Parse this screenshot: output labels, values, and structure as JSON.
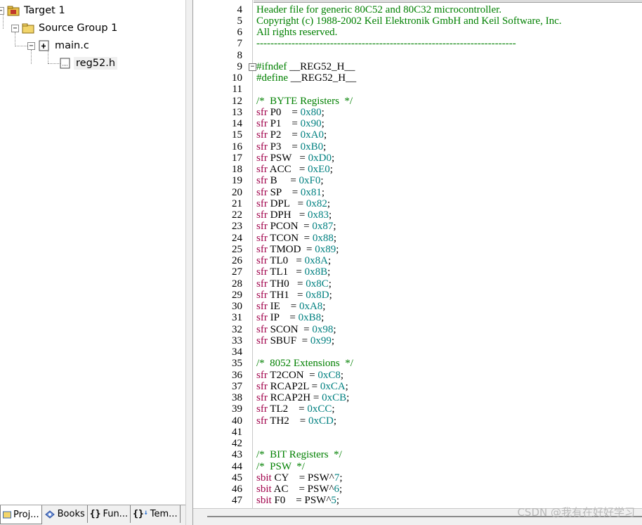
{
  "project_tree": {
    "target": "Target 1",
    "group": "Source Group 1",
    "file_main": "main.c",
    "file_header": "reg52.h"
  },
  "bottom_tabs": [
    {
      "label": "Proj...",
      "icon": "project-icon"
    },
    {
      "label": "Books",
      "icon": "books-icon"
    },
    {
      "label": "Fun...",
      "icon": "functions-icon"
    },
    {
      "label": "Tem...",
      "icon": "templates-icon"
    }
  ],
  "colors": {
    "keyword": "#a0004a",
    "number": "#008080",
    "comment": "#008000",
    "preprocessor": "#008000"
  },
  "code_lines": [
    {
      "n": "4",
      "parts": [
        {
          "c": "cmt",
          "t": "Header file for generic 80C52 and 80C32 microcontroller."
        }
      ]
    },
    {
      "n": "5",
      "parts": [
        {
          "c": "cmt",
          "t": "Copyright (c) 1988-2002 Keil Elektronik GmbH and Keil Software, Inc."
        }
      ]
    },
    {
      "n": "6",
      "parts": [
        {
          "c": "cmt",
          "t": "All rights reserved."
        }
      ]
    },
    {
      "n": "7",
      "parts": [
        {
          "c": "cmt",
          "t": "--------------------------------------------------------------------------"
        }
      ]
    },
    {
      "n": "8",
      "parts": []
    },
    {
      "n": "9",
      "fold": "−",
      "parts": [
        {
          "c": "pp",
          "t": "#ifndef"
        },
        {
          "c": "pln",
          "t": " __REG52_H__"
        }
      ]
    },
    {
      "n": "10",
      "parts": [
        {
          "c": "pp",
          "t": "#define"
        },
        {
          "c": "pln",
          "t": " __REG52_H__"
        }
      ]
    },
    {
      "n": "11",
      "parts": []
    },
    {
      "n": "12",
      "parts": [
        {
          "c": "cmt",
          "t": "/*  BYTE Registers  */"
        }
      ]
    },
    {
      "n": "13",
      "parts": [
        {
          "c": "kw",
          "t": "sfr"
        },
        {
          "c": "pln",
          "t": " P0    = "
        },
        {
          "c": "num",
          "t": "0x80"
        },
        {
          "c": "pln",
          "t": ";"
        }
      ]
    },
    {
      "n": "14",
      "parts": [
        {
          "c": "kw",
          "t": "sfr"
        },
        {
          "c": "pln",
          "t": " P1    = "
        },
        {
          "c": "num",
          "t": "0x90"
        },
        {
          "c": "pln",
          "t": ";"
        }
      ]
    },
    {
      "n": "15",
      "parts": [
        {
          "c": "kw",
          "t": "sfr"
        },
        {
          "c": "pln",
          "t": " P2    = "
        },
        {
          "c": "num",
          "t": "0xA0"
        },
        {
          "c": "pln",
          "t": ";"
        }
      ]
    },
    {
      "n": "16",
      "parts": [
        {
          "c": "kw",
          "t": "sfr"
        },
        {
          "c": "pln",
          "t": " P3    = "
        },
        {
          "c": "num",
          "t": "0xB0"
        },
        {
          "c": "pln",
          "t": ";"
        }
      ]
    },
    {
      "n": "17",
      "parts": [
        {
          "c": "kw",
          "t": "sfr"
        },
        {
          "c": "pln",
          "t": " PSW   = "
        },
        {
          "c": "num",
          "t": "0xD0"
        },
        {
          "c": "pln",
          "t": ";"
        }
      ]
    },
    {
      "n": "18",
      "parts": [
        {
          "c": "kw",
          "t": "sfr"
        },
        {
          "c": "pln",
          "t": " ACC   = "
        },
        {
          "c": "num",
          "t": "0xE0"
        },
        {
          "c": "pln",
          "t": ";"
        }
      ]
    },
    {
      "n": "19",
      "parts": [
        {
          "c": "kw",
          "t": "sfr"
        },
        {
          "c": "pln",
          "t": " B     = "
        },
        {
          "c": "num",
          "t": "0xF0"
        },
        {
          "c": "pln",
          "t": ";"
        }
      ]
    },
    {
      "n": "20",
      "parts": [
        {
          "c": "kw",
          "t": "sfr"
        },
        {
          "c": "pln",
          "t": " SP    = "
        },
        {
          "c": "num",
          "t": "0x81"
        },
        {
          "c": "pln",
          "t": ";"
        }
      ]
    },
    {
      "n": "21",
      "parts": [
        {
          "c": "kw",
          "t": "sfr"
        },
        {
          "c": "pln",
          "t": " DPL   = "
        },
        {
          "c": "num",
          "t": "0x82"
        },
        {
          "c": "pln",
          "t": ";"
        }
      ]
    },
    {
      "n": "22",
      "parts": [
        {
          "c": "kw",
          "t": "sfr"
        },
        {
          "c": "pln",
          "t": " DPH   = "
        },
        {
          "c": "num",
          "t": "0x83"
        },
        {
          "c": "pln",
          "t": ";"
        }
      ]
    },
    {
      "n": "23",
      "parts": [
        {
          "c": "kw",
          "t": "sfr"
        },
        {
          "c": "pln",
          "t": " PCON  = "
        },
        {
          "c": "num",
          "t": "0x87"
        },
        {
          "c": "pln",
          "t": ";"
        }
      ]
    },
    {
      "n": "24",
      "parts": [
        {
          "c": "kw",
          "t": "sfr"
        },
        {
          "c": "pln",
          "t": " TCON  = "
        },
        {
          "c": "num",
          "t": "0x88"
        },
        {
          "c": "pln",
          "t": ";"
        }
      ]
    },
    {
      "n": "25",
      "parts": [
        {
          "c": "kw",
          "t": "sfr"
        },
        {
          "c": "pln",
          "t": " TMOD  = "
        },
        {
          "c": "num",
          "t": "0x89"
        },
        {
          "c": "pln",
          "t": ";"
        }
      ]
    },
    {
      "n": "26",
      "parts": [
        {
          "c": "kw",
          "t": "sfr"
        },
        {
          "c": "pln",
          "t": " TL0   = "
        },
        {
          "c": "num",
          "t": "0x8A"
        },
        {
          "c": "pln",
          "t": ";"
        }
      ]
    },
    {
      "n": "27",
      "parts": [
        {
          "c": "kw",
          "t": "sfr"
        },
        {
          "c": "pln",
          "t": " TL1   = "
        },
        {
          "c": "num",
          "t": "0x8B"
        },
        {
          "c": "pln",
          "t": ";"
        }
      ]
    },
    {
      "n": "28",
      "parts": [
        {
          "c": "kw",
          "t": "sfr"
        },
        {
          "c": "pln",
          "t": " TH0   = "
        },
        {
          "c": "num",
          "t": "0x8C"
        },
        {
          "c": "pln",
          "t": ";"
        }
      ]
    },
    {
      "n": "29",
      "parts": [
        {
          "c": "kw",
          "t": "sfr"
        },
        {
          "c": "pln",
          "t": " TH1   = "
        },
        {
          "c": "num",
          "t": "0x8D"
        },
        {
          "c": "pln",
          "t": ";"
        }
      ]
    },
    {
      "n": "30",
      "parts": [
        {
          "c": "kw",
          "t": "sfr"
        },
        {
          "c": "pln",
          "t": " IE    = "
        },
        {
          "c": "num",
          "t": "0xA8"
        },
        {
          "c": "pln",
          "t": ";"
        }
      ]
    },
    {
      "n": "31",
      "parts": [
        {
          "c": "kw",
          "t": "sfr"
        },
        {
          "c": "pln",
          "t": " IP    = "
        },
        {
          "c": "num",
          "t": "0xB8"
        },
        {
          "c": "pln",
          "t": ";"
        }
      ]
    },
    {
      "n": "32",
      "parts": [
        {
          "c": "kw",
          "t": "sfr"
        },
        {
          "c": "pln",
          "t": " SCON  = "
        },
        {
          "c": "num",
          "t": "0x98"
        },
        {
          "c": "pln",
          "t": ";"
        }
      ]
    },
    {
      "n": "33",
      "parts": [
        {
          "c": "kw",
          "t": "sfr"
        },
        {
          "c": "pln",
          "t": " SBUF  = "
        },
        {
          "c": "num",
          "t": "0x99"
        },
        {
          "c": "pln",
          "t": ";"
        }
      ]
    },
    {
      "n": "34",
      "parts": []
    },
    {
      "n": "35",
      "parts": [
        {
          "c": "cmt",
          "t": "/*  8052 Extensions  */"
        }
      ]
    },
    {
      "n": "36",
      "parts": [
        {
          "c": "kw",
          "t": "sfr"
        },
        {
          "c": "pln",
          "t": " T2CON  = "
        },
        {
          "c": "num",
          "t": "0xC8"
        },
        {
          "c": "pln",
          "t": ";"
        }
      ]
    },
    {
      "n": "37",
      "parts": [
        {
          "c": "kw",
          "t": "sfr"
        },
        {
          "c": "pln",
          "t": " RCAP2L = "
        },
        {
          "c": "num",
          "t": "0xCA"
        },
        {
          "c": "pln",
          "t": ";"
        }
      ]
    },
    {
      "n": "38",
      "parts": [
        {
          "c": "kw",
          "t": "sfr"
        },
        {
          "c": "pln",
          "t": " RCAP2H = "
        },
        {
          "c": "num",
          "t": "0xCB"
        },
        {
          "c": "pln",
          "t": ";"
        }
      ]
    },
    {
      "n": "39",
      "parts": [
        {
          "c": "kw",
          "t": "sfr"
        },
        {
          "c": "pln",
          "t": " TL2    = "
        },
        {
          "c": "num",
          "t": "0xCC"
        },
        {
          "c": "pln",
          "t": ";"
        }
      ]
    },
    {
      "n": "40",
      "parts": [
        {
          "c": "kw",
          "t": "sfr"
        },
        {
          "c": "pln",
          "t": " TH2    = "
        },
        {
          "c": "num",
          "t": "0xCD"
        },
        {
          "c": "pln",
          "t": ";"
        }
      ]
    },
    {
      "n": "41",
      "parts": []
    },
    {
      "n": "42",
      "parts": []
    },
    {
      "n": "43",
      "parts": [
        {
          "c": "cmt",
          "t": "/*  BIT Registers  */"
        }
      ]
    },
    {
      "n": "44",
      "parts": [
        {
          "c": "cmt",
          "t": "/*  PSW  */"
        }
      ]
    },
    {
      "n": "45",
      "parts": [
        {
          "c": "kw",
          "t": "sbit"
        },
        {
          "c": "pln",
          "t": " CY    = PSW^"
        },
        {
          "c": "num",
          "t": "7"
        },
        {
          "c": "pln",
          "t": ";"
        }
      ]
    },
    {
      "n": "46",
      "parts": [
        {
          "c": "kw",
          "t": "sbit"
        },
        {
          "c": "pln",
          "t": " AC    = PSW^"
        },
        {
          "c": "num",
          "t": "6"
        },
        {
          "c": "pln",
          "t": ";"
        }
      ]
    },
    {
      "n": "47",
      "parts": [
        {
          "c": "kw",
          "t": "sbit"
        },
        {
          "c": "pln",
          "t": " F0    = PSW^"
        },
        {
          "c": "num",
          "t": "5"
        },
        {
          "c": "pln",
          "t": ";"
        }
      ]
    }
  ],
  "watermark": "CSDN @我有在好好学习"
}
